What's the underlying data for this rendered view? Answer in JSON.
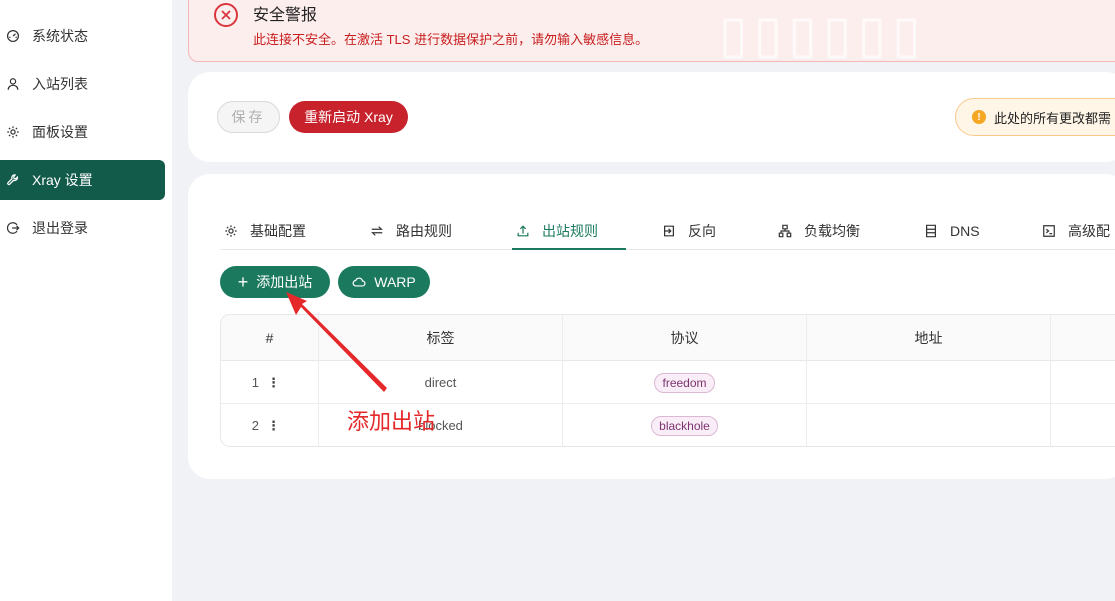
{
  "sidebar": {
    "items": [
      {
        "label": "系统状态",
        "icon": "dashboard-icon"
      },
      {
        "label": "入站列表",
        "icon": "user-icon"
      },
      {
        "label": "面板设置",
        "icon": "gear-icon"
      },
      {
        "label": "Xray 设置",
        "icon": "wrench-icon",
        "active": true
      },
      {
        "label": "退出登录",
        "icon": "logout-icon"
      }
    ]
  },
  "alert": {
    "title": "安全警报",
    "description": "此连接不安全。在激活 TLS 进行数据保护之前，请勿输入敏感信息。"
  },
  "toolbar": {
    "save_label": "保存",
    "restart_label": "重新启动 Xray",
    "notice_text": "此处的所有更改都需"
  },
  "tabs": [
    {
      "label": "基础配置",
      "icon": "gear-icon"
    },
    {
      "label": "路由规则",
      "icon": "swap-icon"
    },
    {
      "label": "出站规则",
      "icon": "upload-icon",
      "active": true
    },
    {
      "label": "反向",
      "icon": "import-icon"
    },
    {
      "label": "负载均衡",
      "icon": "cluster-icon"
    },
    {
      "label": "DNS",
      "icon": "database-icon"
    },
    {
      "label": "高级配",
      "icon": "code-icon"
    }
  ],
  "actions": {
    "add_outbound_label": "添加出站",
    "warp_label": "WARP"
  },
  "table": {
    "headers": [
      "#",
      "标签",
      "协议",
      "地址"
    ],
    "rows": [
      {
        "index": "1",
        "tag": "direct",
        "protocol": "freedom",
        "address": ""
      },
      {
        "index": "2",
        "tag": "blocked",
        "protocol": "blackhole",
        "address": ""
      }
    ]
  },
  "annotation": {
    "text": "添加出站",
    "color": "#e5282a"
  },
  "colors": {
    "primary": "#1b7a5e",
    "sidebar_active": "#125a4a",
    "danger": "#c8232c",
    "warning": "#f5a623"
  }
}
